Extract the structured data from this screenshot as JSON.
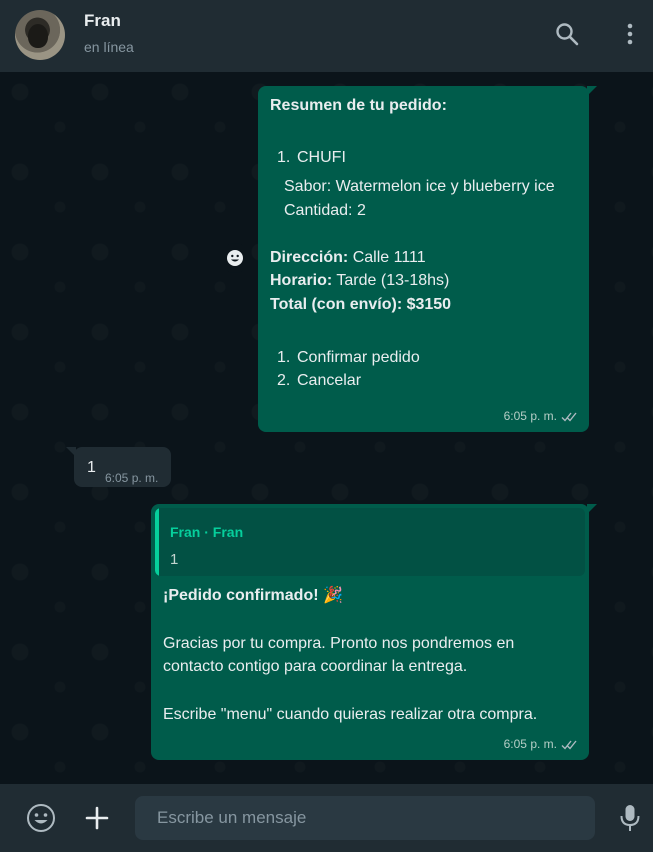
{
  "header": {
    "contact_name": "Fran",
    "status": "en línea",
    "icons": [
      "search-icon",
      "menu-icon"
    ]
  },
  "messages": [
    {
      "direction": "outgoing",
      "title": "Resumen de tu pedido:",
      "item_number": "1.",
      "item_name": "CHUFI",
      "flavor_line": "Sabor: Watermelon ice y blueberry ice",
      "qty_line": "Cantidad: 2",
      "address_label": "Dirección:",
      "address_value": " Calle 1111",
      "schedule_label": "Horario:",
      "schedule_value": " Tarde (13-18hs)",
      "total_line": "Total (con envío): $3150",
      "options": [
        {
          "number": "1.",
          "label": "Confirmar pedido"
        },
        {
          "number": "2.",
          "label": "Cancelar"
        }
      ],
      "time": "6:05 p. m.",
      "status_icon": "double-check-icon"
    },
    {
      "direction": "incoming",
      "text": "1",
      "time": "6:05 p. m."
    },
    {
      "direction": "outgoing",
      "quote_author": "Fran · Fran",
      "quote_text": "1",
      "title": "¡Pedido confirmado! 🎉",
      "body_line1": "Gracias por tu compra. Pronto nos pondremos en",
      "body_line2": "contacto contigo para coordinar la entrega.",
      "body_line3": "Escribe \"menu\" cuando quieras realizar otra compra.",
      "time": "6:05 p. m.",
      "status_icon": "double-check-icon"
    }
  ],
  "composer": {
    "placeholder": "Escribe un mensaje",
    "icons": [
      "emoji-icon",
      "plus-icon",
      "mic-icon"
    ]
  },
  "colors": {
    "header_bg": "#202c33",
    "chat_bg": "#0b141a",
    "outgoing_bubble": "#005c4b",
    "incoming_bubble": "#202c33",
    "quote_accent": "#06cf9c"
  }
}
